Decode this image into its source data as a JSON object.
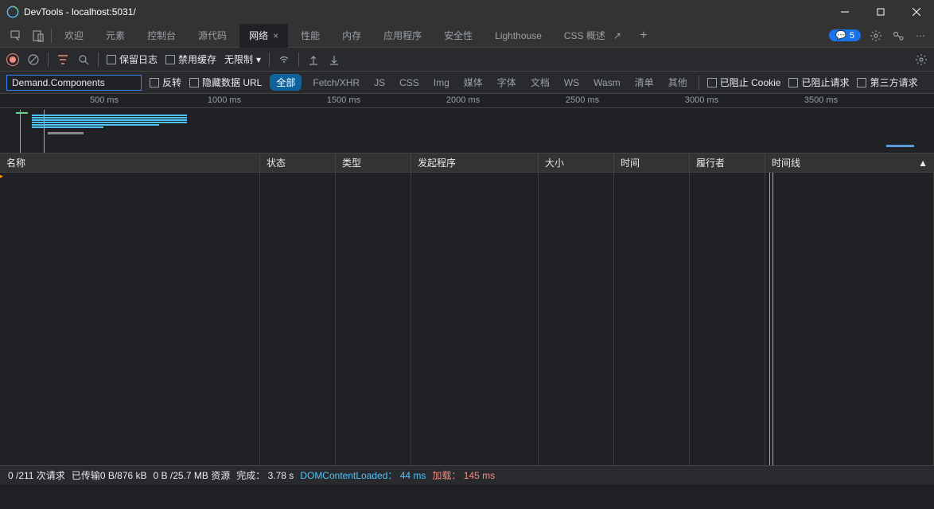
{
  "title": "DevTools - localhost:5031/",
  "tabs": {
    "welcome": "欢迎",
    "elements": "元素",
    "console": "控制台",
    "sources": "源代码",
    "network": "网络",
    "performance": "性能",
    "memory": "内存",
    "application": "应用程序",
    "security": "安全性",
    "lighthouse": "Lighthouse",
    "css_overview": "CSS 概述"
  },
  "issues_count": "5",
  "toolbar": {
    "preserve_log": "保留日志",
    "disable_cache": "禁用缓存",
    "throttle": "无限制"
  },
  "filter_input": "Demand.Components",
  "filter": {
    "invert": "反转",
    "hide_data": "隐藏数据 URL",
    "all": "全部",
    "fetch_xhr": "Fetch/XHR",
    "js": "JS",
    "css": "CSS",
    "img": "Img",
    "media": "媒体",
    "font": "字体",
    "doc": "文档",
    "ws": "WS",
    "wasm": "Wasm",
    "manifest": "清单",
    "other": "其他",
    "blocked_cookies": "已阻止 Cookie",
    "blocked_requests": "已阻止请求",
    "third_party": "第三方请求"
  },
  "ruler": {
    "t1": "500 ms",
    "t2": "1000 ms",
    "t3": "1500 ms",
    "t4": "2000 ms",
    "t5": "2500 ms",
    "t6": "3000 ms",
    "t7": "3500 ms"
  },
  "columns": {
    "name": "名称",
    "status": "状态",
    "type": "类型",
    "initiator": "发起程序",
    "size": "大小",
    "time": "时间",
    "fulfilled_by": "履行者",
    "waterfall": "时间线"
  },
  "status_bar": {
    "requests": "0 /211 次请求",
    "transferred": "已传输0 B/876 kB",
    "resources": "0 B /25.7 MB 资源",
    "finish_label": "完成：",
    "finish_time": "3.78 s",
    "dom_label": "DOMContentLoaded：",
    "dom_time": "44 ms",
    "load_label": "加载：",
    "load_time": "145 ms"
  }
}
